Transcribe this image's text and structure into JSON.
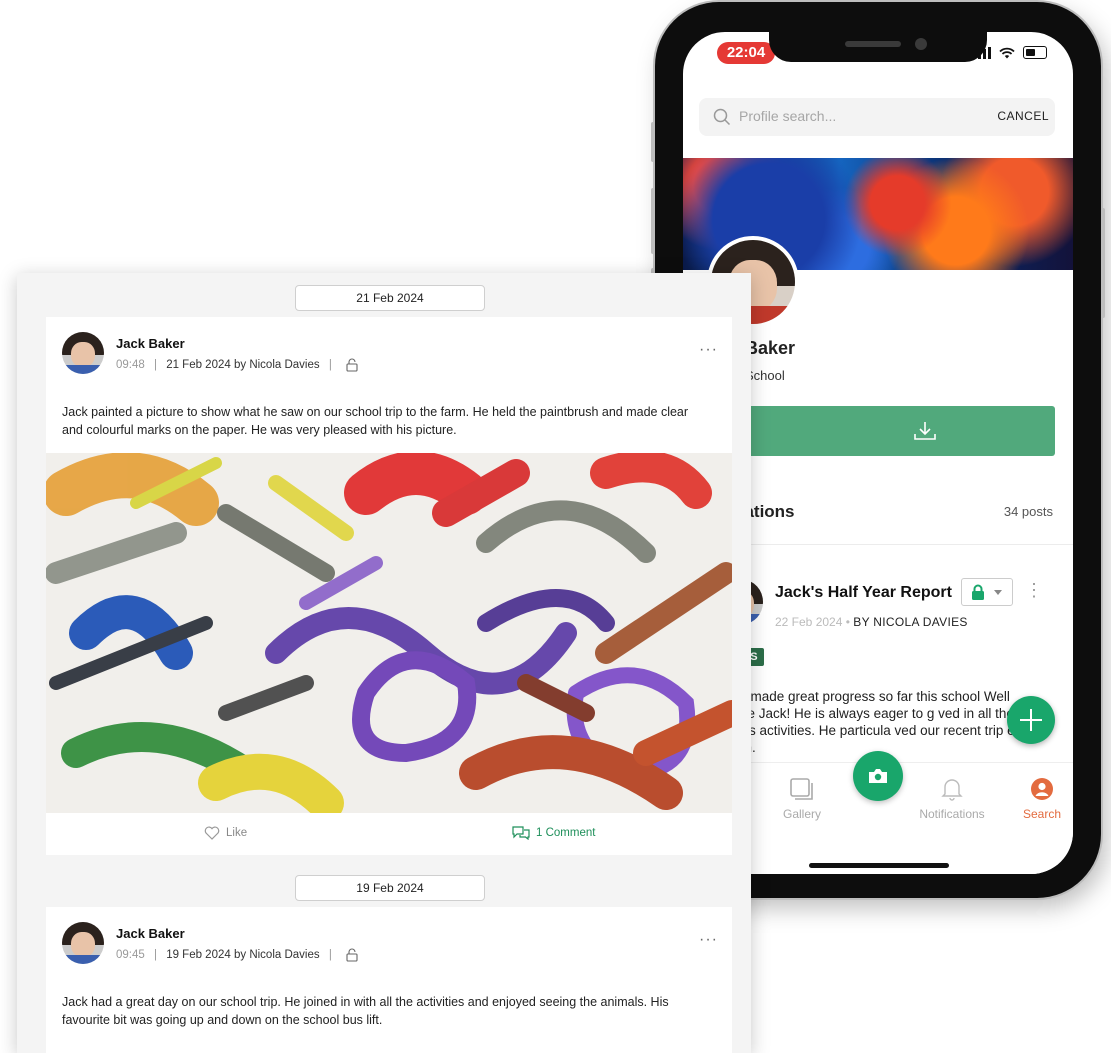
{
  "phone": {
    "status_time": "22:04",
    "search": {
      "placeholder": "Profile search...",
      "cancel_label": "CANCEL"
    },
    "profile": {
      "name_visible": "Baker",
      "school_visible": "School"
    },
    "section": {
      "title_visible": "cations",
      "posts_count": "34 posts"
    },
    "post": {
      "title": "Jack's Half Year Report",
      "date": "22 Feb 2024",
      "author": "BY NICOLA DAVIES",
      "tag": "ORTS",
      "body": "has made great progress so far this school Well done Jack! He is always eager to g ved in all the class activities. He particula ved our recent trip e farm."
    },
    "tabs": [
      {
        "label": "Gallery",
        "icon": "gallery-icon"
      },
      {
        "label": "Notifications",
        "icon": "bell-icon"
      },
      {
        "label": "Search",
        "icon": "profile-icon"
      }
    ],
    "colors": {
      "accent": "#19a66b",
      "download": "#51a97c",
      "active_tab": "#e36b3f",
      "time_pill": "#e53935"
    }
  },
  "feed": {
    "entries": [
      {
        "date_label": "21 Feb 2024",
        "name": "Jack Baker",
        "time": "09:48",
        "date": "21 Feb 2024",
        "by": "by Nicola Davies",
        "text": "Jack painted a picture to show what he saw on our school trip to the farm. He held the paintbrush and made clear and colourful marks on the paper. He was very pleased with his picture.",
        "like_label": "Like",
        "comment_label": "1 Comment"
      },
      {
        "date_label": "19 Feb 2024",
        "name": "Jack Baker",
        "time": "09:45",
        "date": "19 Feb 2024",
        "by": "by Nicola Davies",
        "text": "Jack had a great day on our school trip. He joined in with all the activities and enjoyed seeing the animals. His favourite bit was going up and down on the school bus lift."
      }
    ],
    "separator": "|",
    "more_label": "···"
  }
}
